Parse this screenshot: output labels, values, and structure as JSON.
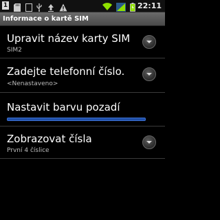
{
  "status_bar": {
    "sim_label": "1",
    "clock": "22:11",
    "colors": {
      "wifi": "#8fe000",
      "signal": "#8fe000",
      "battery": "#8fe000"
    }
  },
  "title": "Informace o kartě SIM",
  "items": [
    {
      "title": "Upravit název karty SIM",
      "summary": "SIM2"
    },
    {
      "title": "Zadejte telefonní číslo.",
      "summary": "<Nenastaveno>"
    },
    {
      "title": "Nastavit barvu pozadí",
      "accent_color": "#1f4ea6"
    },
    {
      "title": "Zobrazovat čísla",
      "summary": "První 4 číslice"
    }
  ]
}
